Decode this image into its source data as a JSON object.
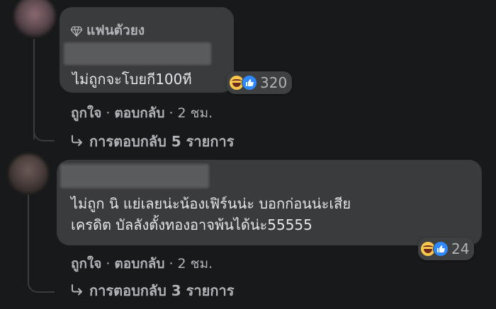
{
  "comments": [
    {
      "badge": "แฟนตัวยง",
      "text": "ไม่ถูกจะโบยกี100ที",
      "reaction_count": "320",
      "reactions": [
        "haha",
        "like"
      ],
      "actions": {
        "like": "ถูกใจ",
        "reply": "ตอบกลับ",
        "time": "2 ชม."
      },
      "replies_label": "การตอบกลับ 5 รายการ"
    },
    {
      "text_line1": "ไม่ถูก นิ แย่เลยน่ะน้องเฟิร์นน่ะ บอกก่อนน่ะเสีย",
      "text_line2": "เครดิต บัลลังตั้งทองอาจพ้นได้น่ะ55555",
      "reaction_count": "24",
      "reactions": [
        "haha",
        "like"
      ],
      "actions": {
        "like": "ถูกใจ",
        "reply": "ตอบกลับ",
        "time": "2 ชม."
      },
      "replies_label": "การตอบกลับ 3 รายการ"
    }
  ],
  "colors": {
    "background": "#18191a",
    "bubble": "#3a3b3c",
    "text": "#e4e6eb",
    "secondary": "#b0b3b8",
    "like_blue": "#2e89ff"
  },
  "icons": [
    "diamond-icon",
    "haha-reaction-icon",
    "like-reaction-icon",
    "reply-arrow-icon"
  ]
}
